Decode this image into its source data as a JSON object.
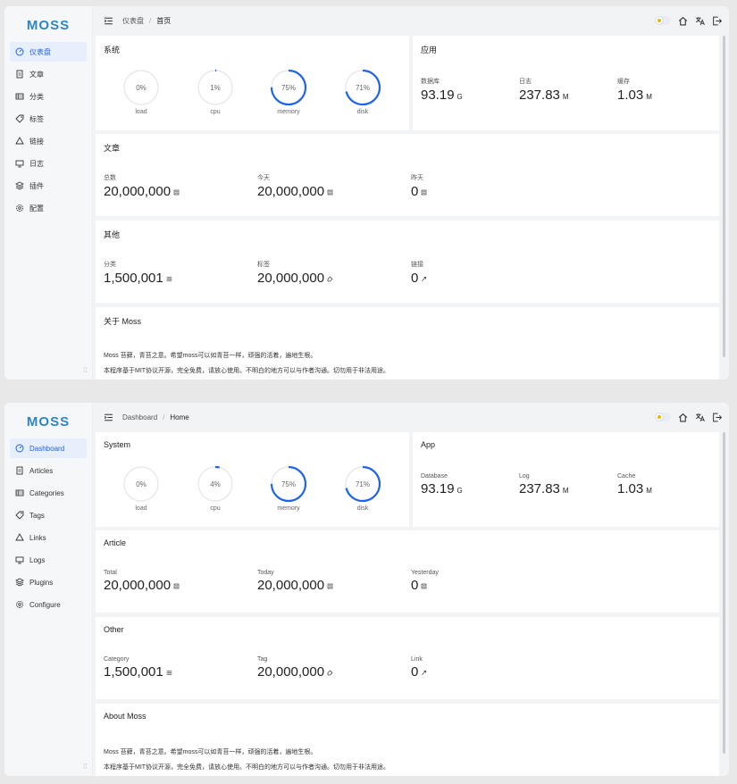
{
  "brand": "MOSS",
  "colors": {
    "accent": "#1f63e6",
    "brand": "#2e86c1",
    "gauge_track": "#e3e5ea"
  },
  "cn": {
    "menu": [
      "仪表盘",
      "文章",
      "分类",
      "标签",
      "链接",
      "日志",
      "插件",
      "配置"
    ],
    "crumbs": [
      "仪表盘",
      "首页"
    ],
    "system": {
      "title": "系统",
      "gauges": [
        {
          "value": "0%",
          "label": "load",
          "pct": 0
        },
        {
          "value": "1%",
          "label": "cpu",
          "pct": 1
        },
        {
          "value": "75%",
          "label": "memory",
          "pct": 75
        },
        {
          "value": "71%",
          "label": "disk",
          "pct": 71
        }
      ]
    },
    "app": {
      "title": "应用",
      "stats": [
        {
          "label": "数据库",
          "value": "93.19",
          "unit": "G"
        },
        {
          "label": "日志",
          "value": "237.83",
          "unit": "M"
        },
        {
          "label": "缓存",
          "value": "1.03",
          "unit": "M"
        }
      ]
    },
    "article": {
      "title": "文章",
      "stats": [
        {
          "label": "总数",
          "value": "20,000,000",
          "icon": "document-icon"
        },
        {
          "label": "今天",
          "value": "20,000,000",
          "icon": "document-icon"
        },
        {
          "label": "昨天",
          "value": "0",
          "icon": "document-icon"
        }
      ]
    },
    "other": {
      "title": "其他",
      "stats": [
        {
          "label": "分类",
          "value": "1,500,001",
          "icon": "list-icon"
        },
        {
          "label": "标签",
          "value": "20,000,000",
          "icon": "tag-icon"
        },
        {
          "label": "链接",
          "value": "0",
          "icon": "link-icon"
        }
      ]
    },
    "about": {
      "title": "关于 Moss",
      "line1": "Moss 苔藓，青苔之意。希望moss可以如青苔一样，顽强的活着，遍地生根。",
      "line2": "本程序基于MIT协议开源，完全免费，请放心使用。不明白的地方可以与作者沟通。切勿用于非法用途。"
    }
  },
  "en": {
    "menu": [
      "Dashboard",
      "Articles",
      "Categories",
      "Tags",
      "Links",
      "Logs",
      "Plugins",
      "Configure"
    ],
    "crumbs": [
      "Dashboard",
      "Home"
    ],
    "system": {
      "title": "System",
      "gauges": [
        {
          "value": "0%",
          "label": "load",
          "pct": 0
        },
        {
          "value": "4%",
          "label": "cpu",
          "pct": 4
        },
        {
          "value": "75%",
          "label": "memory",
          "pct": 75
        },
        {
          "value": "71%",
          "label": "disk",
          "pct": 71
        }
      ]
    },
    "app": {
      "title": "App",
      "stats": [
        {
          "label": "Database",
          "value": "93.19",
          "unit": "G"
        },
        {
          "label": "Log",
          "value": "237.83",
          "unit": "M"
        },
        {
          "label": "Cache",
          "value": "1.03",
          "unit": "M"
        }
      ]
    },
    "article": {
      "title": "Article",
      "stats": [
        {
          "label": "Total",
          "value": "20,000,000",
          "icon": "document-icon"
        },
        {
          "label": "Today",
          "value": "20,000,000",
          "icon": "document-icon"
        },
        {
          "label": "Yesterday",
          "value": "0",
          "icon": "document-icon"
        }
      ]
    },
    "other": {
      "title": "Other",
      "stats": [
        {
          "label": "Category",
          "value": "1,500,001",
          "icon": "list-icon"
        },
        {
          "label": "Tag",
          "value": "20,000,000",
          "icon": "tag-icon"
        },
        {
          "label": "Link",
          "value": "0",
          "icon": "link-icon"
        }
      ]
    },
    "about": {
      "title": "About Moss",
      "line1": "Moss 苔藓，青苔之意。希望moss可以如青苔一样，顽强的活着，遍地生根。",
      "line2": "本程序基于MIT协议开源，完全免费，请放心使用。不明白的地方可以与作者沟通。切勿用于非法用途。"
    }
  }
}
